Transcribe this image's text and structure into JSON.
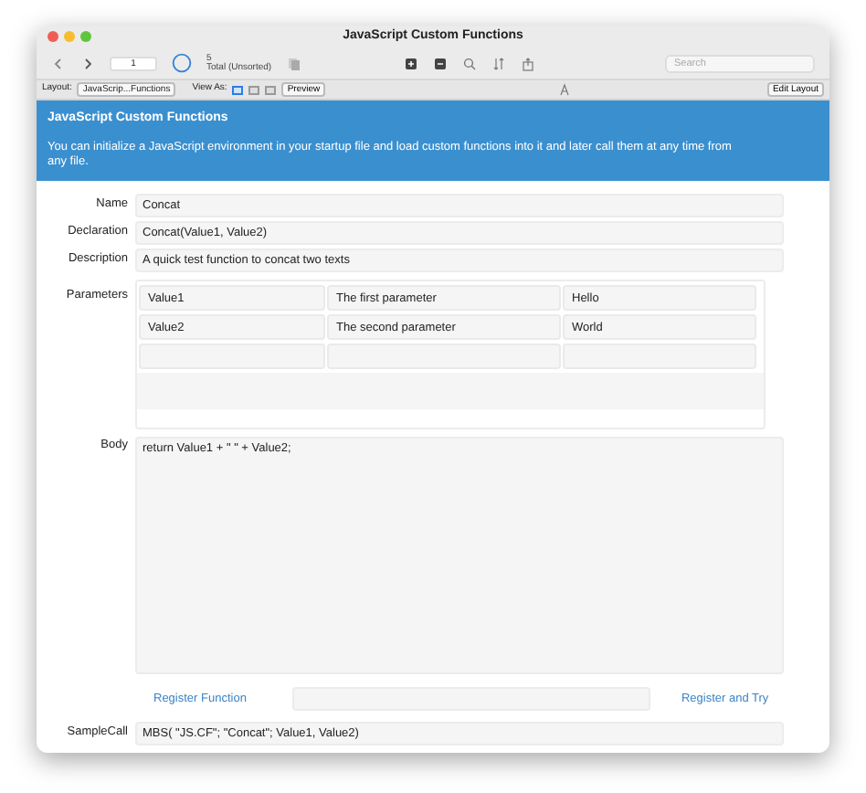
{
  "window": {
    "title": "JavaScript Custom Functions"
  },
  "toolbar": {
    "record": "1",
    "count": "5",
    "found_label": "Total (Unsorted)",
    "search_placeholder": "Search"
  },
  "layout_bar": {
    "layout_label": "Layout:",
    "layout_value": "JavaScrip...Functions",
    "view_as_label": "View As:",
    "view_modes": [
      {
        "selected": true
      },
      {
        "selected": false
      },
      {
        "selected": false
      }
    ],
    "preview": "Preview",
    "edit_layout": "Edit Layout"
  },
  "header": {
    "title": "JavaScript Custom Functions",
    "description": "You can initialize a JavaScript environment in your startup file and load custom functions into it and later call them at any time from any file."
  },
  "fields": [
    {
      "label": "Name",
      "value": "Concat"
    },
    {
      "label": "Declaration",
      "value": "Concat(Value1, Value2)"
    },
    {
      "label": "Description",
      "value": "A quick test function to concat two texts"
    }
  ],
  "parameters": {
    "label": "Parameters",
    "rows": [
      [
        "Value1",
        "The first parameter",
        "Hello"
      ],
      [
        "Value2",
        "The second parameter",
        "World"
      ]
    ]
  },
  "body": {
    "label": "Body",
    "value": "return Value1 + \" \" + Value2;"
  },
  "buttons": [
    "Register Function",
    "Register and Try"
  ],
  "sample_call": {
    "label": "SampleCall",
    "value": "MBS( \"JS.CF\"; \"Concat\"; Value1, Value2)"
  }
}
